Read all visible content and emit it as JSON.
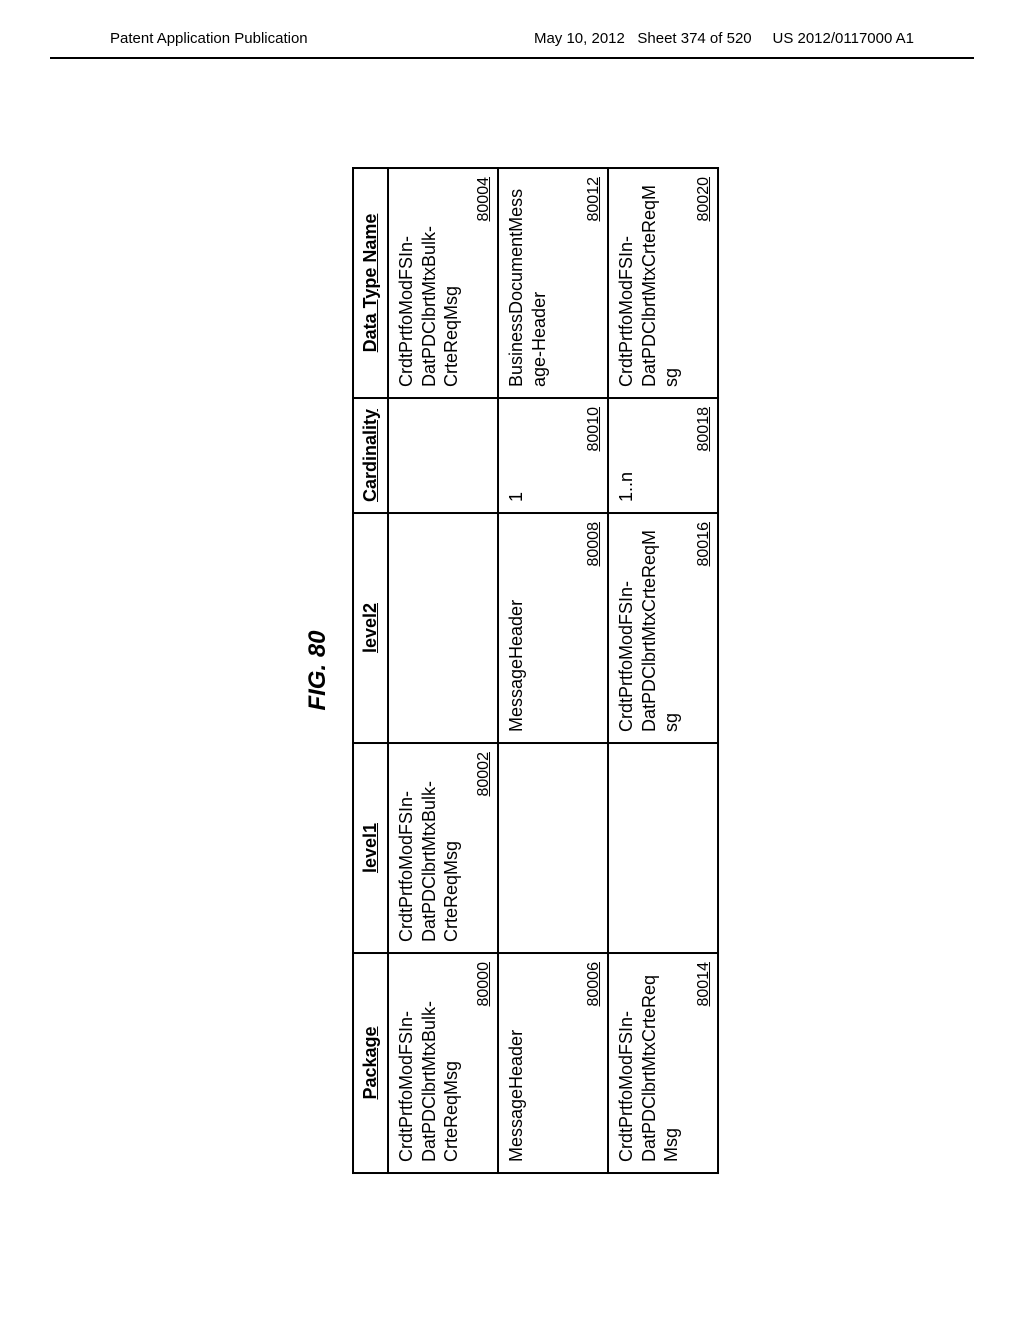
{
  "header": {
    "left": "Patent Application Publication",
    "date": "May 10, 2012",
    "sheet": "Sheet 374 of 520",
    "pubnum": "US 2012/0117000 A1"
  },
  "figure": {
    "title": "FIG. 80",
    "columns": [
      "Package",
      "level1",
      "level2",
      "Cardinality",
      "Data Type Name"
    ],
    "rows": [
      {
        "package": {
          "text": "CrdtPrtfoModFSIn-DatPDClbrtMtxBulk-CrteReqMsg",
          "ref": "80000"
        },
        "level1": {
          "text": "CrdtPrtfoModFSIn-DatPDClbrtMtxBulk-CrteReqMsg",
          "ref": "80002"
        },
        "level2": {
          "text": "",
          "ref": ""
        },
        "cardinality": {
          "text": "",
          "ref": ""
        },
        "datatype": {
          "text": "CrdtPrtfoModFSIn-DatPDClbrtMtxBulk-CrteReqMsg",
          "ref": "80004"
        }
      },
      {
        "package": {
          "text": "MessageHeader",
          "ref": "80006"
        },
        "level1": {
          "text": "",
          "ref": ""
        },
        "level2": {
          "text": "MessageHeader",
          "ref": "80008"
        },
        "cardinality": {
          "text": "1",
          "ref": "80010"
        },
        "datatype": {
          "text": "BusinessDocumentMessage-Header",
          "ref": "80012"
        }
      },
      {
        "package": {
          "text": "CrdtPrtfoModFSIn-DatPDClbrtMtxCrteReq Msg",
          "ref": "80014"
        },
        "level1": {
          "text": "",
          "ref": ""
        },
        "level2": {
          "text": "CrdtPrtfoModFSIn-DatPDClbrtMtxCrteReqMsg",
          "ref": "80016"
        },
        "cardinality": {
          "text": "1..n",
          "ref": "80018"
        },
        "datatype": {
          "text": "CrdtPrtfoModFSIn-DatPDClbrtMtxCrteReqMsg",
          "ref": "80020"
        }
      }
    ]
  }
}
